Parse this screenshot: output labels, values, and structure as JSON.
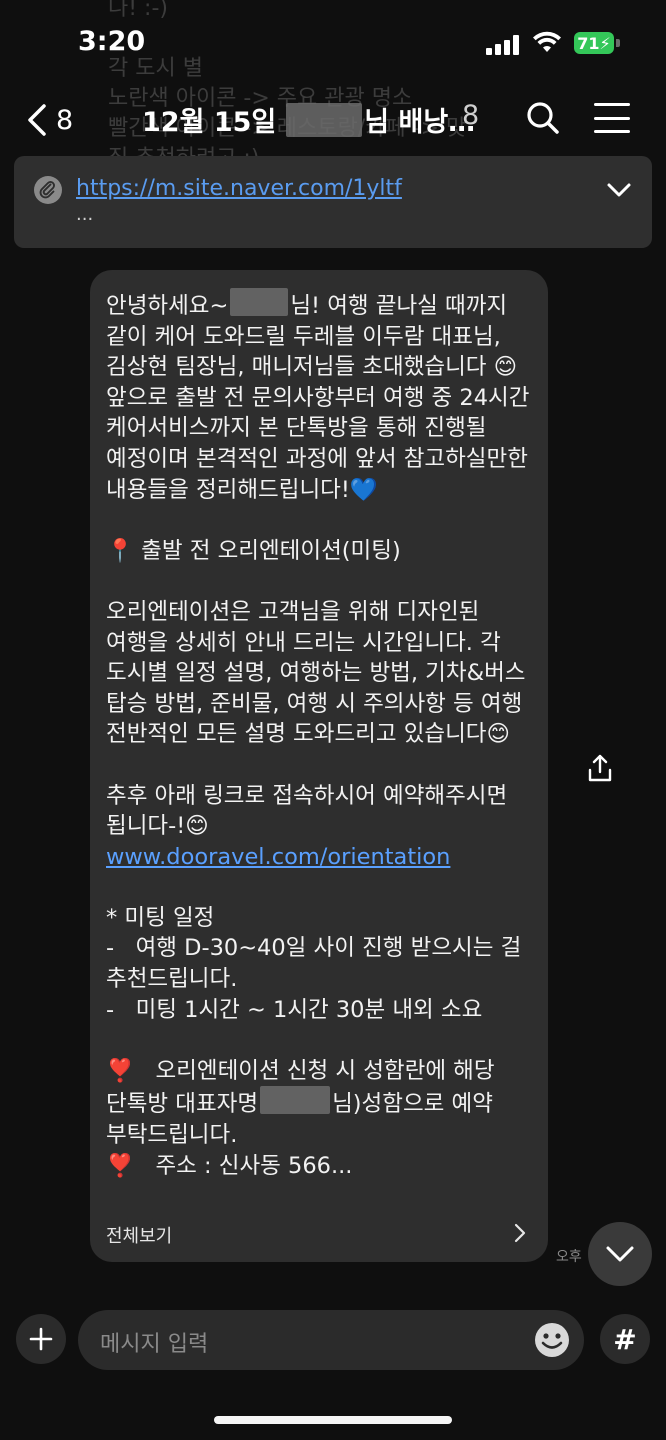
{
  "status_bar": {
    "time": "3:20",
    "battery": "71"
  },
  "background_text": [
    "나! :-)",
    "각 도시 별",
    "노란색 아이콘 -> 주요 관광 명소",
    "빨간색 아이콘 -> 레스토랑/카페 -> 맛",
    "집 추천하려고 :)"
  ],
  "header": {
    "back_count": "8",
    "title_prefix": "12월 15일",
    "title_suffix": "님 배낭…",
    "member_count": "8"
  },
  "notice": {
    "url": "https://m.site.naver.com/1yltf",
    "more": "..."
  },
  "message": {
    "paragraphs": [
      "안녕하세요~",
      "님! 여행 끝나실 때까지 같이 케어 도와드릴 두레블 이두람 대표님, 김상현 팀장님, 매니저님들 초대했습니다 😊 앞으로 출발 전 문의사항부터 여행 중 24시간 케어서비스까지 본 단톡방을 통해 진행될 예정이며 본격적인 과정에 앞서 참고하실만한 내용들을 정리해드립니다!💙",
      "📍 출발 전 오리엔테이션(미팅)",
      "오리엔테이션은 고객님을 위해 디자인된 여행을 상세히 안내 드리는 시간입니다. 각 도시별 일정 설명, 여행하는 방법, 기차&버스 탑승 방법, 준비물, 여행 시 주의사항 등 여행 전반적인 모든 설명 도와드리고 있습니다😊",
      "추후 아래 링크로 접속하시어 예약해주시면 됩니다-!😊",
      "www.dooravel.com/orientation",
      "* 미팅 일정",
      "-   여행 D-30~40일 사이 진행 받으시는 걸 추천드립니다.",
      "-   미팅 1시간 ~ 1시간 30분 내외 소요",
      "❣️   오리엔테이션 신청 시 성함란에 해당 단톡방 대표자명",
      "님)성함으로 예약 부탁드립니다.",
      "❣️   주소 : 신사동 566..."
    ],
    "view_all": "전체보기",
    "time": "오후"
  },
  "input": {
    "placeholder": "메시지 입력",
    "hash": "#"
  }
}
